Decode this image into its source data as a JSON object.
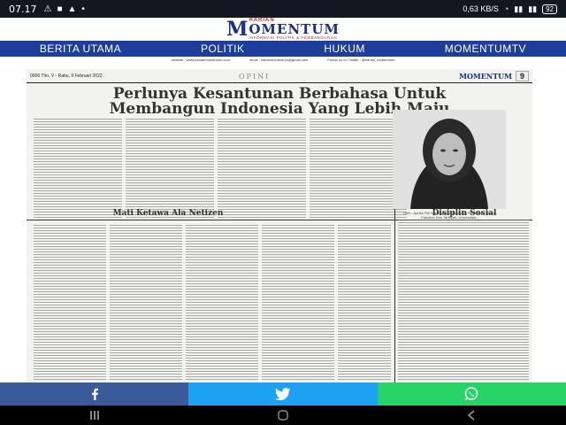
{
  "status_bar": {
    "time": "07.17",
    "network": "0,63 KB/S",
    "battery": "92"
  },
  "brand": {
    "prefix": "HARIAN",
    "name": "OMENTUM",
    "initial": "M",
    "tagline": "INFORMASI POLITIK & PEMBANGUNAN"
  },
  "nav": {
    "items": [
      "BERITA UTAMA",
      "POLITIK",
      "HUKUM",
      "MOMENTUMTV"
    ]
  },
  "paper": {
    "contacts": [
      "website : www.harianmomentum.com",
      "email : harianmomentum@gmail.com",
      "Follow us on Twitter : @harian_momentum"
    ],
    "issue": "0006 Thn. V - Rabu, 9 Februari 2022",
    "url": "www.harianmomentum.com",
    "section": "OPINI",
    "mini_logo": "MOMENTUM",
    "page_number": "9",
    "headline_line1": "Perlunya Kesantunan Berbahasa Untuk",
    "headline_line2": "Membangun Indonesia Yang Lebih Maju",
    "photo_caption": "Oleh : Aprilia Fitri Kurniawan Mahasiswa Pendidikan Bhs In. Fakultas Ilmu Tarbiyah, Universitas...",
    "column_title_left": "Mati Ketawa Ala Netizen",
    "column_title_right": "Disiplin Sosial"
  },
  "share": {
    "facebook": "f",
    "twitter": "twitter",
    "whatsapp": "whatsapp"
  },
  "colors": {
    "nav_bg": "#1d3e9a",
    "facebook": "#3b5a99",
    "twitter": "#1da1f2",
    "whatsapp": "#25d366"
  }
}
